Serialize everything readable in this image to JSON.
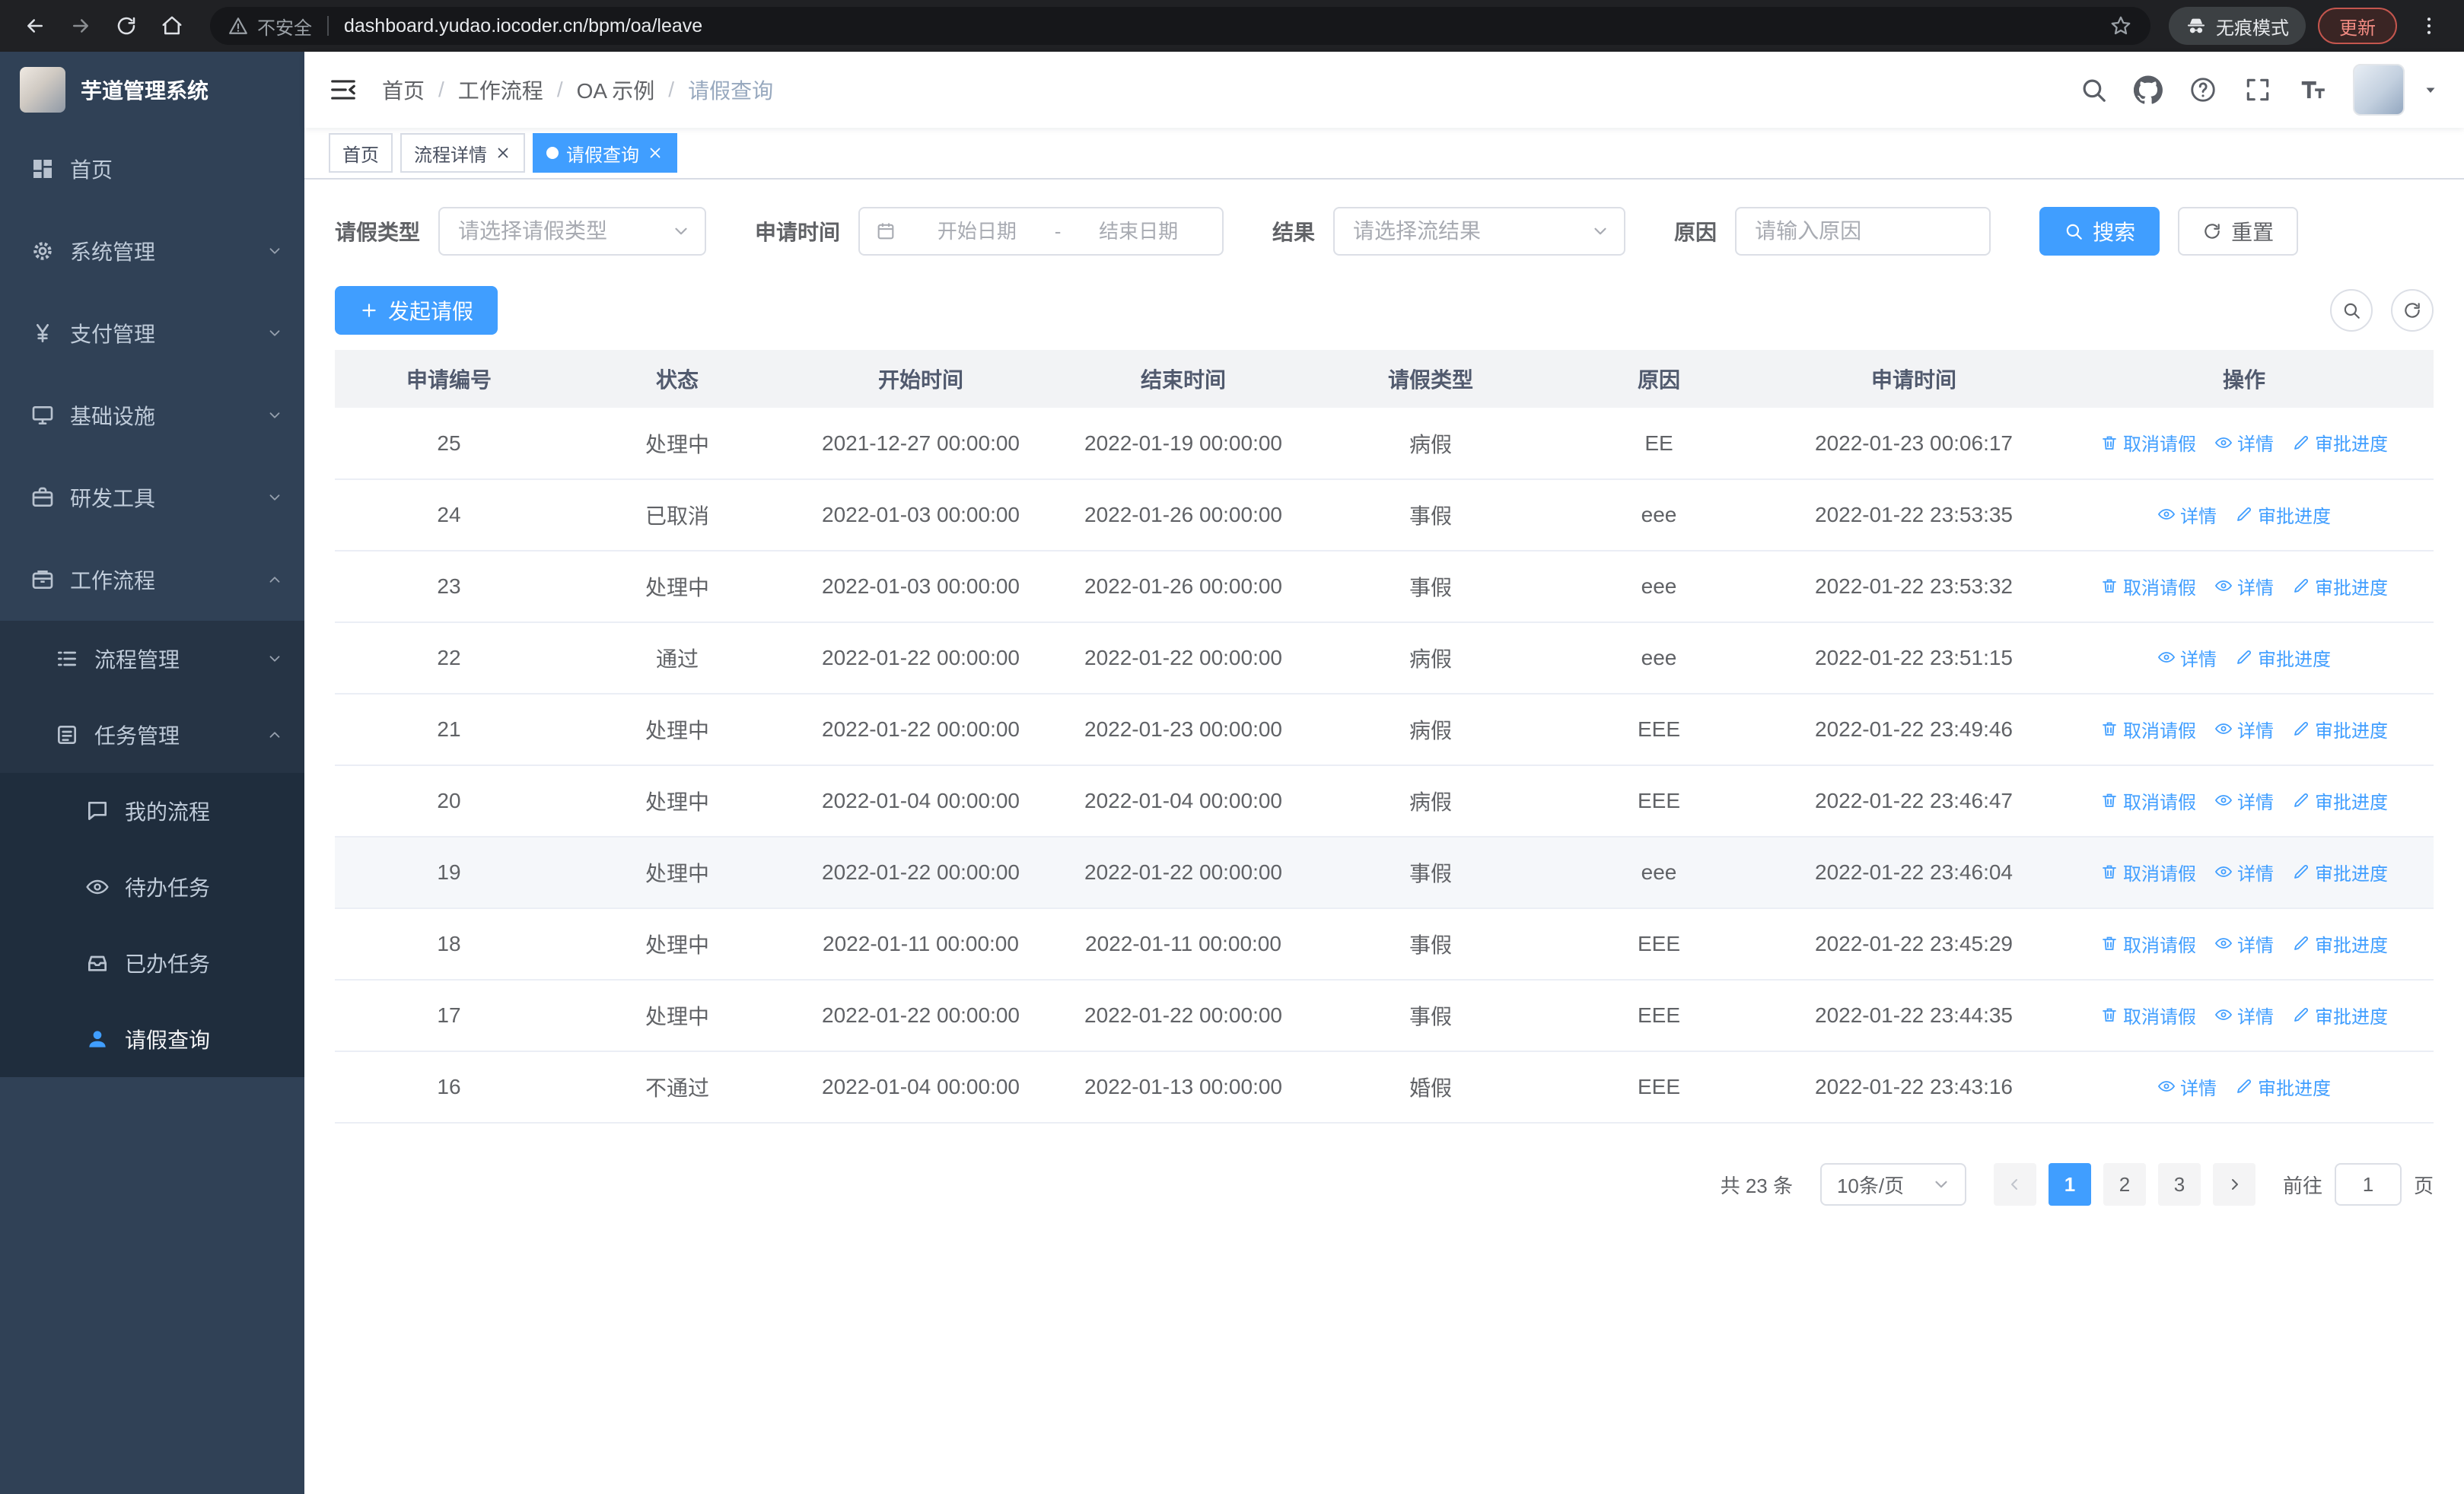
{
  "browser": {
    "security": "不安全",
    "url": "dashboard.yudao.iocoder.cn/bpm/oa/leave",
    "incognito": "无痕模式",
    "update": "更新"
  },
  "sidebar": {
    "title": "芋道管理系统",
    "menu": [
      {
        "label": "首页",
        "icon": "home"
      },
      {
        "label": "系统管理",
        "icon": "gear",
        "arrow": "down"
      },
      {
        "label": "支付管理",
        "icon": "yen",
        "arrow": "down"
      },
      {
        "label": "基础设施",
        "icon": "infra",
        "arrow": "down"
      },
      {
        "label": "研发工具",
        "icon": "tools",
        "arrow": "down"
      },
      {
        "label": "工作流程",
        "icon": "workflow",
        "arrow": "up",
        "expanded": true,
        "children": [
          {
            "label": "流程管理",
            "icon": "process",
            "arrow": "down"
          },
          {
            "label": "任务管理",
            "icon": "task",
            "arrow": "up",
            "expanded": true,
            "children": [
              {
                "label": "我的流程",
                "icon": "chat"
              },
              {
                "label": "待办任务",
                "icon": "eye"
              },
              {
                "label": "已办任务",
                "icon": "done"
              },
              {
                "label": "请假查询",
                "icon": "user",
                "active": true
              }
            ]
          }
        ]
      }
    ]
  },
  "navbar": {
    "breadcrumb": [
      "首页",
      "工作流程",
      "OA 示例",
      "请假查询"
    ]
  },
  "tabs": [
    {
      "label": "首页",
      "closable": false,
      "active": false
    },
    {
      "label": "流程详情",
      "closable": true,
      "active": false
    },
    {
      "label": "请假查询",
      "closable": true,
      "active": true
    }
  ],
  "filters": {
    "leave_type_label": "请假类型",
    "leave_type_placeholder": "请选择请假类型",
    "apply_time_label": "申请时间",
    "start_placeholder": "开始日期",
    "range_separator": "-",
    "end_placeholder": "结束日期",
    "result_label": "结果",
    "result_placeholder": "请选择流结果",
    "reason_label": "原因",
    "reason_placeholder": "请输入原因",
    "search_label": "搜索",
    "reset_label": "重置"
  },
  "toolbar": {
    "create_label": "发起请假"
  },
  "table": {
    "columns": [
      "申请编号",
      "状态",
      "开始时间",
      "结束时间",
      "请假类型",
      "原因",
      "申请时间",
      "操作"
    ],
    "op_labels": {
      "cancel": "取消请假",
      "detail": "详情",
      "progress": "审批进度"
    },
    "rows": [
      {
        "id": "25",
        "status": "处理中",
        "start": "2021-12-27 00:00:00",
        "end": "2022-01-19 00:00:00",
        "type": "病假",
        "reason": "EE",
        "applied": "2022-01-23 00:06:17",
        "ops": [
          "cancel",
          "detail",
          "progress"
        ]
      },
      {
        "id": "24",
        "status": "已取消",
        "start": "2022-01-03 00:00:00",
        "end": "2022-01-26 00:00:00",
        "type": "事假",
        "reason": "eee",
        "applied": "2022-01-22 23:53:35",
        "ops": [
          "detail",
          "progress"
        ]
      },
      {
        "id": "23",
        "status": "处理中",
        "start": "2022-01-03 00:00:00",
        "end": "2022-01-26 00:00:00",
        "type": "事假",
        "reason": "eee",
        "applied": "2022-01-22 23:53:32",
        "ops": [
          "cancel",
          "detail",
          "progress"
        ]
      },
      {
        "id": "22",
        "status": "通过",
        "start": "2022-01-22 00:00:00",
        "end": "2022-01-22 00:00:00",
        "type": "病假",
        "reason": "eee",
        "applied": "2022-01-22 23:51:15",
        "ops": [
          "detail",
          "progress"
        ]
      },
      {
        "id": "21",
        "status": "处理中",
        "start": "2022-01-22 00:00:00",
        "end": "2022-01-23 00:00:00",
        "type": "病假",
        "reason": "EEE",
        "applied": "2022-01-22 23:49:46",
        "ops": [
          "cancel",
          "detail",
          "progress"
        ]
      },
      {
        "id": "20",
        "status": "处理中",
        "start": "2022-01-04 00:00:00",
        "end": "2022-01-04 00:00:00",
        "type": "病假",
        "reason": "EEE",
        "applied": "2022-01-22 23:46:47",
        "ops": [
          "cancel",
          "detail",
          "progress"
        ]
      },
      {
        "id": "19",
        "status": "处理中",
        "start": "2022-01-22 00:00:00",
        "end": "2022-01-22 00:00:00",
        "type": "事假",
        "reason": "eee",
        "applied": "2022-01-22 23:46:04",
        "ops": [
          "cancel",
          "detail",
          "progress"
        ],
        "hover": true
      },
      {
        "id": "18",
        "status": "处理中",
        "start": "2022-01-11 00:00:00",
        "end": "2022-01-11 00:00:00",
        "type": "事假",
        "reason": "EEE",
        "applied": "2022-01-22 23:45:29",
        "ops": [
          "cancel",
          "detail",
          "progress"
        ]
      },
      {
        "id": "17",
        "status": "处理中",
        "start": "2022-01-22 00:00:00",
        "end": "2022-01-22 00:00:00",
        "type": "事假",
        "reason": "EEE",
        "applied": "2022-01-22 23:44:35",
        "ops": [
          "cancel",
          "detail",
          "progress"
        ]
      },
      {
        "id": "16",
        "status": "不通过",
        "start": "2022-01-04 00:00:00",
        "end": "2022-01-13 00:00:00",
        "type": "婚假",
        "reason": "EEE",
        "applied": "2022-01-22 23:43:16",
        "ops": [
          "detail",
          "progress"
        ]
      }
    ]
  },
  "pagination": {
    "total": "共 23 条",
    "page_size": "10条/页",
    "pages": [
      "1",
      "2",
      "3"
    ],
    "current": "1",
    "goto_label": "前往",
    "goto_value": "1",
    "page_unit": "页"
  },
  "colors": {
    "primary": "#409eff",
    "sidebar_bg": "#304156",
    "chrome_bg": "#202124"
  }
}
